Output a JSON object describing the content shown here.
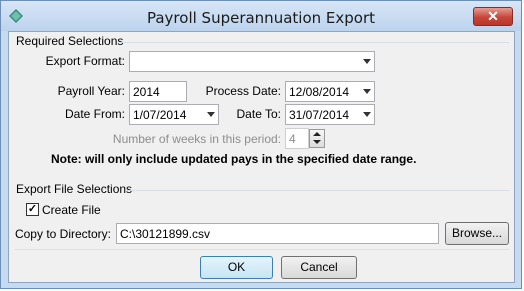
{
  "window": {
    "title": "Payroll Superannuation Export"
  },
  "required": {
    "group_label": "Required Selections",
    "export_format_label": "Export Format:",
    "export_format_value": "",
    "payroll_year_label": "Payroll Year:",
    "payroll_year_value": "2014",
    "process_date_label": "Process Date:",
    "process_date_value": "12/08/2014",
    "date_from_label": "Date From:",
    "date_from_value": "1/07/2014",
    "date_to_label": "Date To:",
    "date_to_value": "31/07/2014",
    "weeks_label": "Number of weeks in this period:",
    "weeks_value": "4",
    "note": "Note: will only include updated pays in the specified date range."
  },
  "export": {
    "group_label": "Export File Selections",
    "create_file_label": "Create File",
    "create_file_checked": true,
    "copy_dir_label": "Copy to Directory:",
    "copy_dir_value": "C:\\30121899.csv",
    "browse_label": "Browse..."
  },
  "buttons": {
    "ok": "OK",
    "cancel": "Cancel"
  },
  "icons": {
    "app": "diamond-app-icon",
    "close": "close-icon",
    "check": "check-icon"
  }
}
